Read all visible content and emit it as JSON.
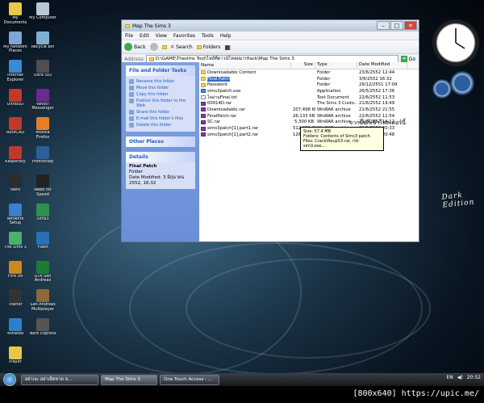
{
  "desktop_icons": [
    {
      "label": "My Documents",
      "color": "#e8c64b"
    },
    {
      "label": "My Computer",
      "color": "#b8c7d8"
    },
    {
      "label": "My Network Places",
      "color": "#7fa6d6"
    },
    {
      "label": "Recycle Bin",
      "color": "#7fb0d0"
    },
    {
      "label": "Internet Explorer",
      "color": "#3a8ad8"
    },
    {
      "label": "Ultra ISO",
      "color": "#4f4f4f"
    },
    {
      "label": "UltraISO",
      "color": "#c0392b"
    },
    {
      "label": "Yahoo! Messenger",
      "color": "#6b2a8c"
    },
    {
      "label": "AutoCAD",
      "color": "#c0392b"
    },
    {
      "label": "Mozilla Firefox",
      "color": "#e67e22"
    },
    {
      "label": "Kaspersky",
      "color": "#c0392b"
    },
    {
      "label": "Photoshop",
      "color": "#2c5f9c"
    },
    {
      "label": "Nero",
      "color": "#2c2c2c"
    },
    {
      "label": "Need for Speed",
      "color": "#222222"
    },
    {
      "label": "Network Setup",
      "color": "#3a7fd0"
    },
    {
      "label": "Sims3",
      "color": "#2f8f4f"
    },
    {
      "label": "The Sims 3",
      "color": "#4fb06b"
    },
    {
      "label": "Flash",
      "color": "#2b6fb5"
    },
    {
      "label": "FIFA 09",
      "color": "#c88a1a"
    },
    {
      "label": "GTA San Andreas",
      "color": "#1f7a3a"
    },
    {
      "label": "Trainer",
      "color": "#333333"
    },
    {
      "label": "San Andreas Multiplayer",
      "color": "#8a6a3a"
    },
    {
      "label": "4shared",
      "color": "#2a7fcf"
    },
    {
      "label": "Nero Express",
      "color": "#555555"
    },
    {
      "label": "Player",
      "color": "#e8c64b"
    }
  ],
  "window": {
    "title": "Map The Sims 3",
    "menu": [
      "File",
      "Edit",
      "View",
      "Favorites",
      "Tools",
      "Help"
    ],
    "toolbar": {
      "back": "Back",
      "search": "Search",
      "folders": "Folders"
    },
    "address_label": "Address",
    "address_value": "D:\\GAME\\Thesims Tool\\ไฟล์ที่ดาวน์โหลดมา\\Hack\\Map The Sims 3",
    "go_label": "Go",
    "columns": {
      "name": "Name",
      "size": "Size",
      "type": "Type",
      "date": "Date Modified"
    },
    "files": [
      {
        "name": "Downloadable Content",
        "size": "",
        "type": "Folder",
        "date": "23/6/2552 12:44",
        "kind": "folder"
      },
      {
        "name": "Final Patch",
        "size": "",
        "type": "Folder",
        "date": "3/6/2552 16:32",
        "kind": "folder",
        "selected": true
      },
      {
        "name": "Password",
        "size": "",
        "type": "Folder",
        "date": "29/12/2551 17:09",
        "kind": "folder"
      },
      {
        "name": "sims3patch.exe",
        "size": "",
        "type": "Application",
        "date": "26/5/2552 17:36",
        "kind": "app"
      },
      {
        "name": "ไล่อ่านFinal.txt",
        "size": "",
        "type": "Text Document",
        "date": "22/6/2552 11:53",
        "kind": "txt"
      },
      {
        "name": "00014D.rar",
        "size": "",
        "type": "The Sims 3 Custo...",
        "date": "21/6/2552 19:49",
        "kind": "rar"
      },
      {
        "name": "Downloadable.rar",
        "size": "207,498 KB",
        "type": "WinRAR archive",
        "date": "21/6/2552 21:55",
        "kind": "rar"
      },
      {
        "name": "FinalPatch.rar",
        "size": "26,133 KB",
        "type": "WinRAR archive",
        "date": "22/6/2552 11:54",
        "kind": "rar"
      },
      {
        "name": "SC.rar",
        "size": "5,300 KB",
        "type": "WinRAR archive",
        "date": "21/6/2552 14:12",
        "kind": "rar"
      },
      {
        "name": "sims3patch[1].part1.rar",
        "size": "512,000 KB",
        "type": "WinRAR archive",
        "date": "21/6/2552 20:33",
        "kind": "rar"
      },
      {
        "name": "sims3patch[1].part2.rar",
        "size": "126,030 KB",
        "type": "WinRAR archive",
        "date": "21/6/2552 20:48",
        "kind": "rar"
      }
    ],
    "tooltip": {
      "line1": "Size: 57.4 MB",
      "line2": "Folders: Contents of Sims3 patch",
      "line3": "Files: Crack\\Reup53.rar, rld-sim3.exe,..."
    },
    "annotation": "จากนั้นก็เข้าโฟลเดอร์นี้",
    "tasks_panel": {
      "title": "File and Folder Tasks",
      "items": [
        "Rename this folder",
        "Move this folder",
        "Copy this folder",
        "Publish this folder to the Web",
        "Share this folder",
        "E-mail this folder's files",
        "Delete this folder"
      ]
    },
    "other_places": "Other Places",
    "details": {
      "title": "Details",
      "name": "Final Patch",
      "type": "Folder",
      "modified": "Date Modified: 3 มิถุนายน 2552, 16:32"
    }
  },
  "taskbar": {
    "buttons": [
      "อย่าเงะ อย่าเด็ดขาด อ...",
      "Map The Sims 3",
      "One Touch Access - ..."
    ],
    "lang": "EN",
    "time": "20:52"
  },
  "desktop_text": {
    "edition": "Dark Edition"
  },
  "watermark": "[800x640] https://upic.me/"
}
